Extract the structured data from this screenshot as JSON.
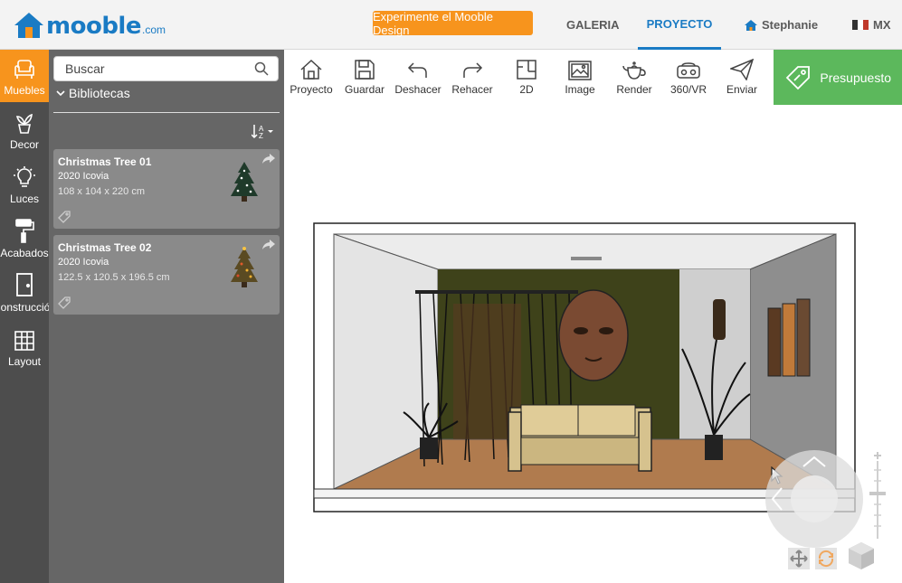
{
  "header": {
    "logo_text": "mooble",
    "logo_suffix": ".com",
    "cta_label": "Experimente el Mooble Design",
    "nav": {
      "galeria": "GALERIA",
      "proyecto": "PROYECTO",
      "user": "Stephanie",
      "country": "MX"
    }
  },
  "categories": [
    {
      "label": "Muebles",
      "icon": "armchair-icon",
      "active": true
    },
    {
      "label": "Decor",
      "icon": "plant-icon"
    },
    {
      "label": "Luces",
      "icon": "lightbulb-icon"
    },
    {
      "label": "Acabados",
      "icon": "paint-roller-icon"
    },
    {
      "label": "Construcción",
      "icon": "door-icon"
    },
    {
      "label": "Layout",
      "icon": "grid-icon"
    }
  ],
  "library": {
    "search_placeholder": "Buscar",
    "section_label": "Bibliotecas",
    "items": [
      {
        "title": "Christmas Tree 01",
        "brand": "2020 Icovia",
        "dims": "108 x 104 x 220 cm"
      },
      {
        "title": "Christmas Tree 02",
        "brand": "2020 Icovia",
        "dims": "122.5 x 120.5 x 196.5 cm"
      }
    ]
  },
  "toolbar": {
    "items": [
      {
        "label": "Proyecto",
        "icon": "home-icon"
      },
      {
        "label": "Guardar",
        "icon": "save-icon"
      },
      {
        "label": "Deshacer",
        "icon": "undo-icon"
      },
      {
        "label": "Rehacer",
        "icon": "redo-icon"
      },
      {
        "label": "2D",
        "icon": "floorplan-icon"
      },
      {
        "label": "Image",
        "icon": "image-icon"
      },
      {
        "label": "Render",
        "icon": "teapot-icon"
      },
      {
        "label": "360/VR",
        "icon": "vr-headset-icon"
      },
      {
        "label": "Enviar",
        "icon": "send-icon"
      }
    ],
    "budget_label": "Presupuesto"
  },
  "colors": {
    "brand_blue": "#1a7bc4",
    "accent_orange": "#f7941d",
    "budget_green": "#5cb85c",
    "sidebar_dark": "#4d4d4d",
    "panel_gray": "#666666"
  }
}
